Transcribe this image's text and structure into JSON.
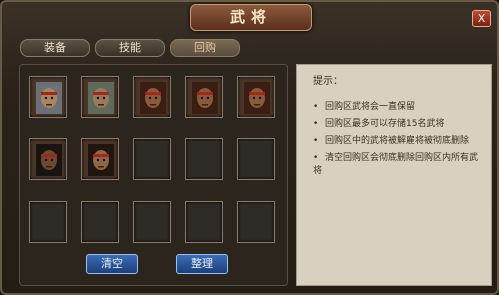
{
  "window": {
    "title": "武将",
    "close_label": "X"
  },
  "tabs": [
    {
      "label": "装备",
      "active": false
    },
    {
      "label": "技能",
      "active": false
    },
    {
      "label": "回购",
      "active": true
    }
  ],
  "slots": [
    {
      "hero": "general-young-helmet"
    },
    {
      "hero": "general-old-armored"
    },
    {
      "hero": "warrior-headband"
    },
    {
      "hero": "warrior-headband"
    },
    {
      "hero": "warrior-headband"
    },
    {
      "hero": "general-bearded"
    },
    {
      "hero": "general-topknot"
    },
    {
      "hero": ""
    },
    {
      "hero": ""
    },
    {
      "hero": ""
    },
    {
      "hero": ""
    },
    {
      "hero": ""
    },
    {
      "hero": ""
    },
    {
      "hero": ""
    },
    {
      "hero": ""
    }
  ],
  "buttons": {
    "clear_label": "清空",
    "sort_label": "整理"
  },
  "tips": {
    "title": "提示：",
    "bullet": "•",
    "items": [
      "回购区武将会一直保留",
      "回购区最多可以存储15名武将",
      "回购区中的武将被解雇将被彻底删除",
      "清空回购区会彻底删除回购区内所有武将"
    ]
  },
  "colors": {
    "accent_blue": "#2a56a0",
    "title_red": "#6e3a26"
  }
}
